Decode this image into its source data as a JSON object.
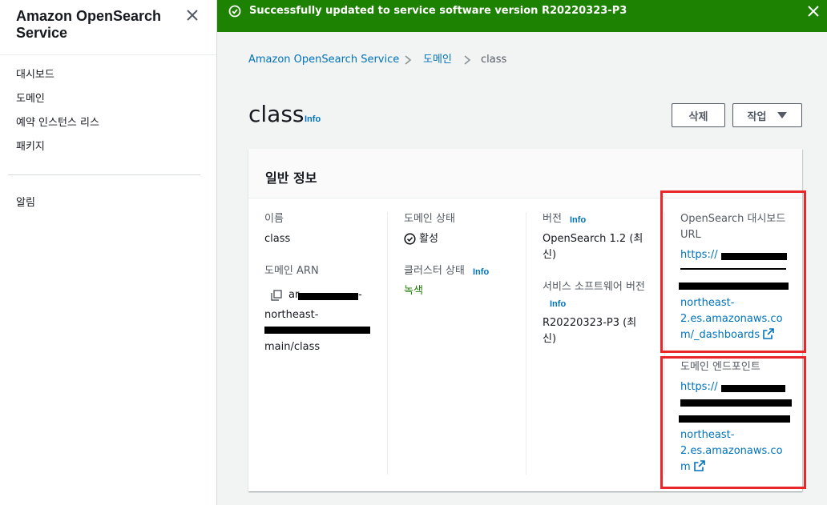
{
  "sidebar": {
    "title": "Amazon OpenSearch Service",
    "items": [
      {
        "label": "대시보드"
      },
      {
        "label": "도메인"
      },
      {
        "label": "예약 인스턴스 리스"
      },
      {
        "label": "패키지"
      }
    ],
    "bottom_items": [
      {
        "label": "알림"
      }
    ]
  },
  "flash": {
    "message": "Successfully updated to service software version R20220323-P3",
    "color": "#1d8102"
  },
  "breadcrumb": {
    "items": [
      "Amazon OpenSearch Service",
      "도메인"
    ],
    "current": "class"
  },
  "header": {
    "title": "class",
    "info": "Info",
    "delete_label": "삭제",
    "actions_label": "작업"
  },
  "panel": {
    "title": "일반 정보",
    "name_label": "이름",
    "name_value": "class",
    "arn_label": "도메인 ARN",
    "arn_line1": "ar",
    "arn_line2": "northeast-",
    "arn_line4": "main/class",
    "status_label": "도메인 상태",
    "status_value": "활성",
    "cluster_label": "클러스터 상태",
    "cluster_info": "Info",
    "cluster_value": "녹색",
    "version_label": "버전",
    "version_info": "Info",
    "version_line1": "OpenSearch 1.2 (최",
    "version_line2": "신)",
    "software_label": "서비스 소프트웨어 버전",
    "software_info": "Info",
    "software_line1": "R20220323-P3 (최",
    "software_line2": "신)",
    "dashboard_label_line1": "OpenSearch 대시보드",
    "dashboard_label_line2": "URL",
    "dashboard_url_line1": "https://",
    "dashboard_url_line4": "northeast-",
    "dashboard_url_line5": "2.es.amazonaws.co",
    "dashboard_url_line6": "m/_dashboards",
    "endpoint_label": "도메인 엔드포인트",
    "endpoint_url_line1": "https://",
    "endpoint_url_line4": "northeast-",
    "endpoint_url_line5": "2.es.amazonaws.co",
    "endpoint_url_line6": "m"
  },
  "colors": {
    "link": "#0073bb",
    "highlight": "#e8272b",
    "status_green": "#1d8102"
  }
}
